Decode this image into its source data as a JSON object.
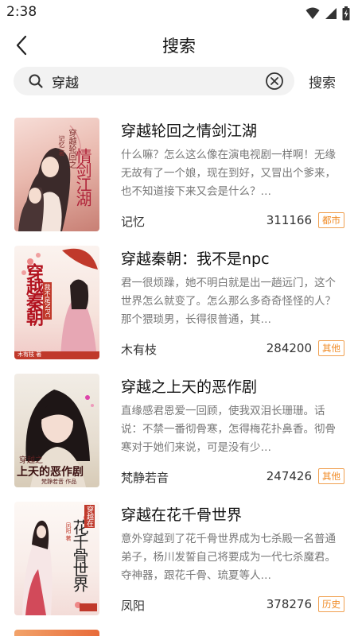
{
  "status_bar": {
    "time": "2:38"
  },
  "header": {
    "title": "搜索"
  },
  "search": {
    "query": "穿越",
    "button_label": "搜索"
  },
  "books": [
    {
      "title": "穿越轮回之情剑江湖",
      "description": "什么嘛？怎么这么像在演电视剧一样啊！无缘无故有了一个娘，现在到好，又冒出个爹来，也不知道接下来又会是什么？…",
      "author": "记忆",
      "count": "311166",
      "tag": "都市",
      "cover": {
        "main": "情剑江湖",
        "side": "穿越轮回之",
        "sub": "记忆 著"
      }
    },
    {
      "title": "穿越秦朝：我不是npc",
      "description": "君一很烦躁，她不明白就是出一趟远门，这个世界怎么就变了。怎么那么多奇奇怪怪的人？那个猥琐男，长得很普通，其…",
      "author": "木有枝",
      "count": "284200",
      "tag": "其他",
      "cover": {
        "main": "穿越秦朝",
        "side": "我不是NPC",
        "sub": "木有枝 著"
      }
    },
    {
      "title": "穿越之上天的恶作剧",
      "description": "直缘感君恩爱一回顾，使我双泪长珊珊。话说：不禁一番彻骨寒，怎得梅花扑鼻香。彻骨寒对于她们来说，可是没有少…",
      "author": "梵静若音",
      "count": "247426",
      "tag": "其他",
      "cover": {
        "main": "上天的恶作剧",
        "side": "穿越之",
        "sub": "梵静若音 作品"
      }
    },
    {
      "title": "穿越在花千骨世界",
      "description": "意外穿越到了花千骨世界成为七杀殿一名普通弟子，杨川发誓自己将要成为一代七杀魔君。夺神器，跟花千骨、琉夏等人…",
      "author": "凤阳",
      "count": "378276",
      "tag": "历史",
      "cover": {
        "main": "花千骨世界",
        "side": "穿越在",
        "sub": "凤阳 著"
      }
    }
  ]
}
